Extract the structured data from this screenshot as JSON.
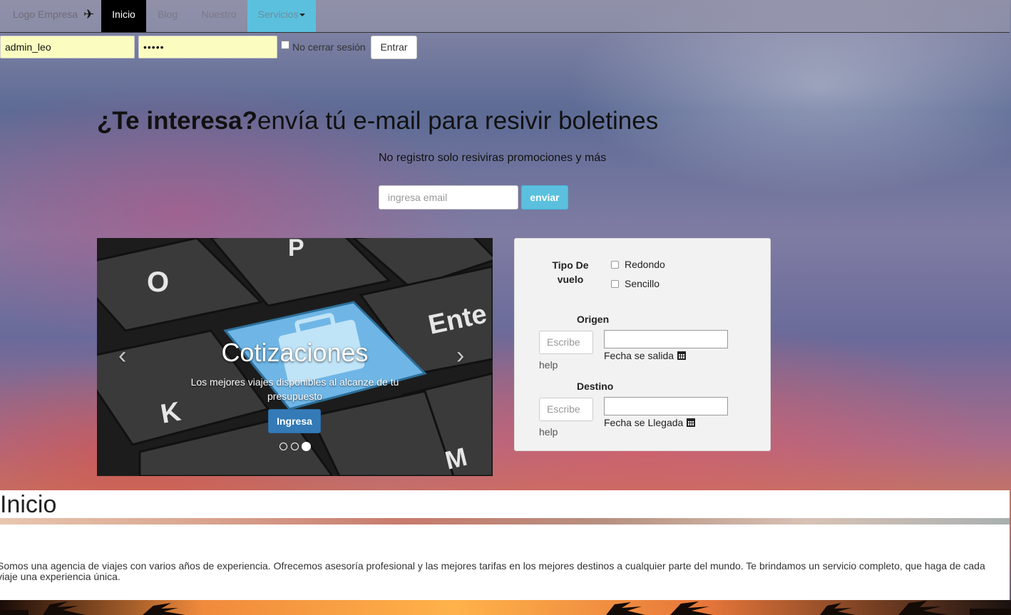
{
  "navbar": {
    "brand": "Logo Empresa",
    "brand_icon": "plane-icon",
    "items": [
      {
        "label": "Inicio",
        "active": true
      },
      {
        "label": "Blog"
      },
      {
        "label": "Nuestro"
      },
      {
        "label": "Servicios"
      }
    ]
  },
  "login": {
    "username": "admin_leo",
    "password": "•••••",
    "remember_label": "No cerrar sesión",
    "submit_label": "Entrar"
  },
  "newsletter": {
    "headline_bold": "¿Te interesa?",
    "headline_rest": "envía tú e-mail para resivir boletines",
    "note": "No registro solo resiviras promociones y más",
    "email_placeholder": "ingresa email",
    "submit_label": "enviar"
  },
  "carousel": {
    "title": "Cotizaciones",
    "subtitle": "Los mejores viajes disponibles al alcanze de tu presupuesto",
    "button_label": "Ingresa",
    "slides_total": 3,
    "active_slide": 3
  },
  "flight_form": {
    "trip_type_label": "Tipo De vuelo",
    "options": [
      "Redondo",
      "Sencillo"
    ],
    "origin_label": "Origen",
    "origin_placeholder": "Escribe",
    "origin_help": "help",
    "departure_label": "Fecha se salida",
    "destination_label": "Destino",
    "destination_placeholder": "Escribe",
    "destination_help": "help",
    "arrival_label": "Fecha se Llegada"
  },
  "about": {
    "title": "Inicio",
    "text": "Somos una agencia de viajes con varios años de experiencia. Ofrecemos asesoría profesional y las mejores tarifas en los mejores destinos a cualquier parte del mundo. Te brindamos un servicio completo, que haga de cada viaje una experiencia única."
  },
  "colors": {
    "navbar_active": "#000000",
    "services_bg": "#5bc0de",
    "info_button": "#5bc0de",
    "primary_button": "#337ab7",
    "login_field_bg": "#fbfdc0"
  }
}
